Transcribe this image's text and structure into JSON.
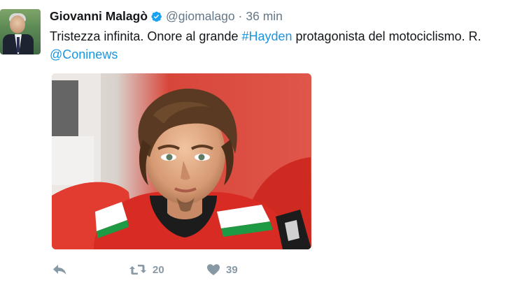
{
  "tweet": {
    "author_name": "Giovanni Malagò",
    "author_handle": "@giomalago",
    "separator": "·",
    "time": "36 min",
    "text_before": "Tristezza infinita. Onore al grande ",
    "hashtag": "#Hayden",
    "text_after": " protagonista del motociclismo. R.",
    "mention": "@Coninews"
  },
  "actions": {
    "retweet_count": "20",
    "like_count": "39"
  },
  "icons": {
    "verified": "verified-badge-icon",
    "reply": "reply-icon",
    "retweet": "retweet-icon",
    "like": "heart-icon"
  },
  "colors": {
    "link": "#1b95e0",
    "muted": "#8899a6",
    "verified": "#1da1f2"
  }
}
